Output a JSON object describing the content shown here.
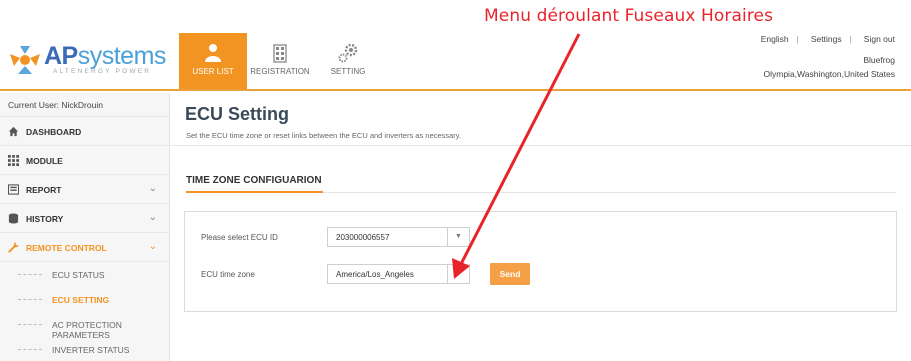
{
  "annotation": {
    "text": "Menu déroulant Fuseaux Horaires",
    "color": "#e8242a"
  },
  "brand": {
    "name_ap": "AP",
    "name_systems": "systems",
    "tagline": "ALTENERGY POWER"
  },
  "nav": {
    "tabs": [
      {
        "label": "USER LIST",
        "icon": "users-icon",
        "active": true
      },
      {
        "label": "REGISTRATION",
        "icon": "building-icon",
        "active": false
      },
      {
        "label": "SETTING",
        "icon": "gears-icon",
        "active": false
      }
    ]
  },
  "top_links": {
    "language": "English",
    "settings": "Settings",
    "sign_out": "Sign out"
  },
  "user_info": {
    "name": "Bluefrog",
    "location": "Olympia,Washington,United States"
  },
  "sidebar": {
    "current_user": "Current User: NickDrouin",
    "items": [
      {
        "label": "DASHBOARD",
        "icon": "home-icon"
      },
      {
        "label": "MODULE",
        "icon": "grid-icon"
      },
      {
        "label": "REPORT",
        "icon": "report-icon",
        "chevron": "⌄"
      },
      {
        "label": "HISTORY",
        "icon": "database-icon",
        "chevron": "⌄"
      },
      {
        "label": "REMOTE CONTROL",
        "icon": "wrench-icon",
        "chevron": "⌄"
      }
    ],
    "sub_items": [
      {
        "label": "ECU STATUS"
      },
      {
        "label": "ECU SETTING",
        "active": true
      },
      {
        "label": "AC PROTECTION PARAMETERS"
      },
      {
        "label": "INVERTER STATUS"
      }
    ]
  },
  "main": {
    "title": "ECU Setting",
    "description": "Set the ECU time zone or reset links between the ECU and inverters as necessary.",
    "section_title": "TIME ZONE CONFIGUARION",
    "ecu_id_label": "Please select ECU ID",
    "ecu_id_value": "203000006557",
    "tz_label": "ECU time zone",
    "tz_value": "America/Los_Angeles",
    "send_label": "Send"
  },
  "colors": {
    "accent": "#f29422",
    "brand_blue": "#3a6ab8",
    "annotation_red": "#e8242a"
  }
}
